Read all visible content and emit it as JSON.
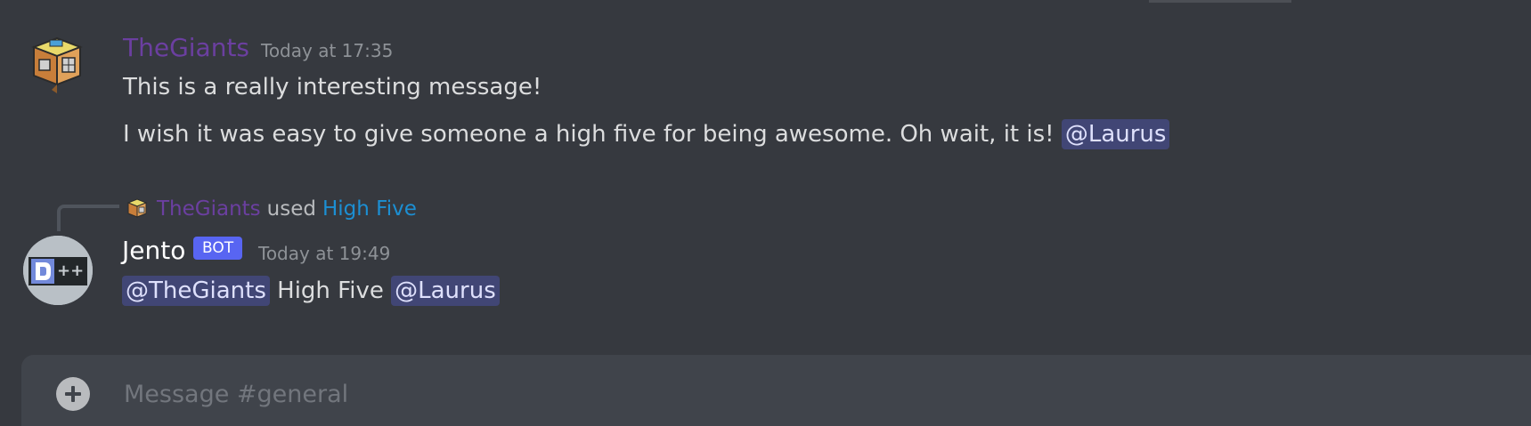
{
  "messages": [
    {
      "author": "TheGiants",
      "timestamp": "Today at 17:35",
      "lines": [
        "This is a really interesting message!",
        "I wish it was easy to give someone a high five for being awesome. Oh wait, it is!"
      ],
      "mention": "@Laurus",
      "author_color": "#6b3fa0"
    },
    {
      "reply": {
        "user": "TheGiants",
        "used": "used",
        "command": "High Five",
        "command_color": "#1c8fd3"
      },
      "author": "Jento",
      "badge": "BOT",
      "timestamp": "Today at 19:49",
      "mention_1": "@TheGiants",
      "text": "High Five",
      "mention_2": "@Laurus"
    }
  ],
  "composer": {
    "placeholder": "Message #general"
  },
  "colors": {
    "background": "#36393f",
    "mention_bg": "#414675",
    "bot_badge": "#5865f2",
    "composer_bg": "#40444b"
  },
  "icons": {
    "giants_avatar": "house-box-avatar-icon",
    "jento_avatar": "jento-bot-avatar-icon",
    "reply_user_icon": "house-box-small-icon",
    "composer_add": "plus-icon"
  }
}
